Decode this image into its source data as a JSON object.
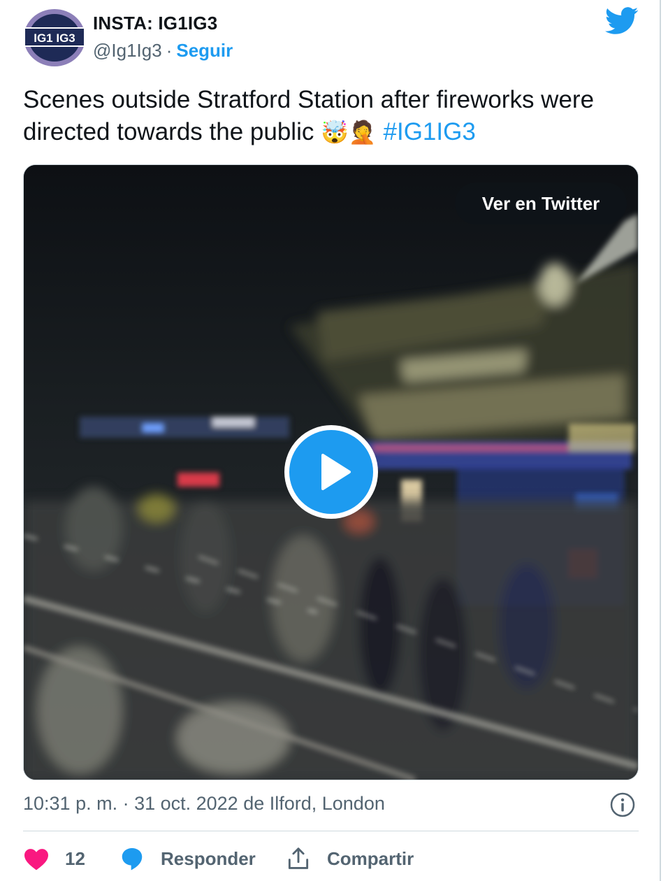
{
  "author": {
    "name": "INSTA: IG1IG3",
    "handle": "@Ig1Ig3",
    "separator": "·",
    "follow_label": "Seguir",
    "avatar_text": "IG1 IG3"
  },
  "tweet": {
    "text": "Scenes outside Stratford Station after fireworks were directed towards the public",
    "emoji_1": "🤯",
    "emoji_2": "🤦",
    "hashtag": "#IG1IG3"
  },
  "media": {
    "watch_label": "Ver en Twitter",
    "play_icon": "play-icon"
  },
  "meta": {
    "timestamp": "10:31 p. m. · 31 oct. 2022 de Ilford, London",
    "info_icon": "info-icon"
  },
  "actions": {
    "like_count": "12",
    "reply_label": "Responder",
    "share_label": "Compartir"
  },
  "colors": {
    "brand_blue": "#1d9bf0",
    "like_pink": "#f91880",
    "text_primary": "#0f1419",
    "text_secondary": "#536471",
    "avatar_ring": "#5a4b8a"
  }
}
